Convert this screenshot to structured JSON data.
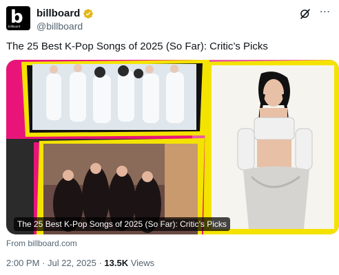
{
  "account": {
    "avatar_text": "b",
    "avatar_small_text": "billboard",
    "name": "billboard",
    "handle": "@billboard"
  },
  "icons": {
    "verified": "verified-badge-icon",
    "grok": "grok-icon",
    "more": "more-options-icon"
  },
  "colors": {
    "verified_gold": "#e2b719",
    "text_primary": "#0f1419",
    "text_secondary": "#536471",
    "card_yellow": "#f4e300",
    "card_pink": "#e9147a",
    "card_green": "#b8e3b0"
  },
  "tweet": {
    "text": "The 25 Best K-Pop Songs of 2025 (So Far): Critic’s Picks"
  },
  "card": {
    "caption": "The 25 Best K-Pop Songs of 2025 (So Far): Critic’s Picks",
    "source": "From billboard.com"
  },
  "meta": {
    "time": "2:00 PM",
    "separator1": " · ",
    "date": "Jul 22, 2025",
    "separator2": " · ",
    "views_count": "13.5K",
    "views_label": " Views"
  }
}
